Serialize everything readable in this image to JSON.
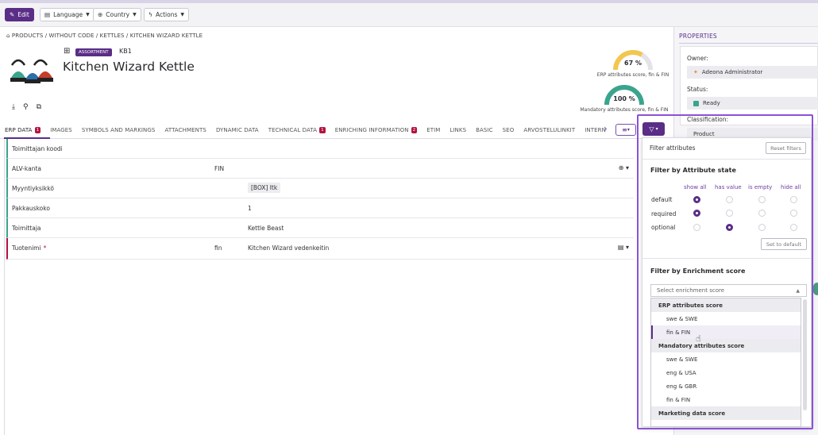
{
  "toolbar": {
    "edit": "Edit",
    "language": "Language",
    "country": "Country",
    "actions": "Actions"
  },
  "breadcrumb": "PRODUCTS / WITHOUT CODE / KETTLES / KITCHEN WIZARD KETTLE",
  "product": {
    "badge": "ASSORTMENT",
    "code": "KB1",
    "title": "Kitchen Wizard Kettle"
  },
  "scores": [
    {
      "value": "67 %",
      "label": "ERP attributes score, fin & FIN",
      "fraction": 0.67,
      "color": "#f3c74f"
    },
    {
      "value": "100 %",
      "label": "Mandatory attributes score, fin & FIN",
      "fraction": 1.0,
      "color": "#3aa58c"
    }
  ],
  "tabs": [
    {
      "label": "ERP DATA",
      "count": "1"
    },
    {
      "label": "IMAGES",
      "count": ""
    },
    {
      "label": "SYMBOLS AND MARKINGS",
      "count": ""
    },
    {
      "label": "ATTACHMENTS",
      "count": ""
    },
    {
      "label": "DYNAMIC DATA",
      "count": ""
    },
    {
      "label": "TECHNICAL DATA",
      "count": "1"
    },
    {
      "label": "ENRICHING INFORMATION",
      "count": "2"
    },
    {
      "label": "ETIM",
      "count": ""
    },
    {
      "label": "LINKS",
      "count": ""
    },
    {
      "label": "BASIC",
      "count": ""
    },
    {
      "label": "SEO",
      "count": ""
    },
    {
      "label": "ARVOSTELULINKIT",
      "count": ""
    },
    {
      "label": "INTERN",
      "count": ""
    }
  ],
  "rows": [
    {
      "label": "Toimittajan koodi",
      "lang": "",
      "value": ""
    },
    {
      "label": "ALV-kanta",
      "lang": "FIN",
      "value": ""
    },
    {
      "label": "Myyntiyksikkö",
      "lang": "",
      "value": "[BOX] ltk"
    },
    {
      "label": "Pakkauskoko",
      "lang": "",
      "value": "1"
    },
    {
      "label": "Toimittaja",
      "lang": "",
      "value": "Kettle Beast"
    },
    {
      "label": "Tuotenimi",
      "lang": "fin",
      "value": "Kitchen Wizard vedenkeitin",
      "required": "*"
    }
  ],
  "properties": {
    "title": "PROPERTIES",
    "owner_label": "Owner:",
    "owner_value": "Adeona Administrator",
    "status_label": "Status:",
    "status_value": "Ready",
    "classification_label": "Classification:",
    "classification_value": "Product"
  },
  "filter_panel": {
    "title": "Filter attributes",
    "reset": "Reset filters",
    "state_title": "Filter by Attribute state",
    "columns": [
      "show all",
      "has value",
      "is empty",
      "hide all"
    ],
    "states": [
      {
        "label": "default",
        "selected": 0
      },
      {
        "label": "required",
        "selected": 0
      },
      {
        "label": "optional",
        "selected": 1
      }
    ],
    "set_default": "Set to default",
    "enrichment_title": "Filter by Enrichment score",
    "select_placeholder": "Select enrichment score",
    "groups": [
      {
        "label": "ERP attributes score",
        "options": [
          "swe & SWE",
          "fin & FIN"
        ]
      },
      {
        "label": "Mandatory attributes score",
        "options": [
          "swe & SWE",
          "eng & USA",
          "eng & GBR",
          "fin & FIN"
        ]
      },
      {
        "label": "Marketing data score",
        "options": []
      }
    ],
    "hovered_option": "fin & FIN"
  }
}
